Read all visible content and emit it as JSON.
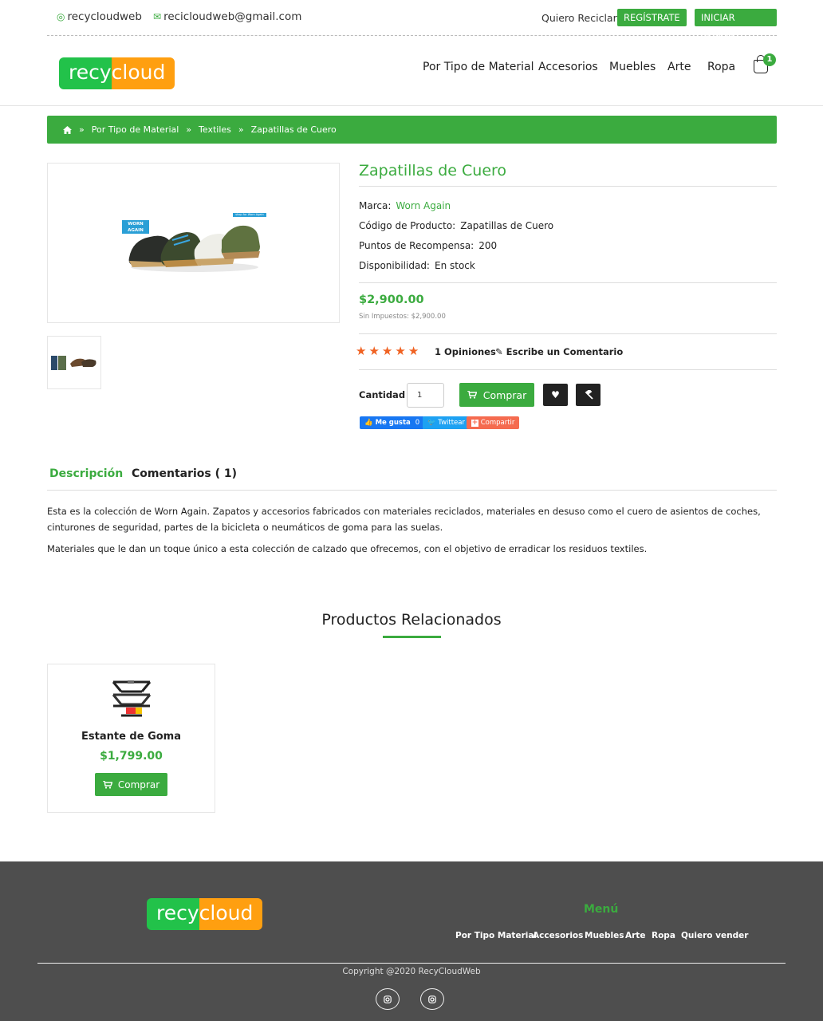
{
  "topbar": {
    "instagram": "recycloudweb",
    "email": "recicloudweb@gmail.com",
    "quiero_reciclar": "Quiero Reciclar",
    "register": "REGÍSTRATE",
    "login": "INICIAR SESIÓN"
  },
  "brand": {
    "logo_green": "recy",
    "logo_orange": "cloud"
  },
  "nav": {
    "items": [
      "Por Tipo de Material",
      "Accesorios",
      "Muebles",
      "Arte",
      "Ropa"
    ],
    "cart_count": "1"
  },
  "breadcrumb": [
    "Por Tipo de Material",
    "Textiles",
    "Zapatillas de Cuero"
  ],
  "product": {
    "title": "Zapatillas de Cuero",
    "brand_label": "Marca:",
    "brand_value": "Worn Again",
    "code_label": "Código de Producto:",
    "code_value": "Zapatillas de Cuero",
    "points_label": "Puntos de Recompensa:",
    "points_value": "200",
    "availability_label": "Disponibilidad:",
    "availability_value": "En stock",
    "price": "$2,900.00",
    "price_no_tax": "Sin Impuestos: $2,900.00",
    "rating": 5,
    "reviews_link": "1 Opiniones",
    "write_review": "Escribe un Comentario",
    "qty_label": "Cantidad",
    "qty_value": "1",
    "buy_label": "Comprar",
    "image_badge": "WORN AGAIN",
    "image_tag": "shop for Worn Again"
  },
  "social": {
    "like": "Me gusta",
    "like_count": "0",
    "tweet": "Twittear",
    "share": "Compartir"
  },
  "tabs": {
    "description": "Descripción",
    "comments": "Comentarios ( 1)"
  },
  "description": {
    "p1": "Esta es la colección de Worn Again. Zapatos y accesorios fabricados con materiales reciclados, materiales en desuso como el cuero de asientos de coches, cinturones de seguridad, partes de la bicicleta o neumáticos de goma para las suelas.",
    "p2": "Materiales que le dan un toque único a esta colección de calzado que ofrecemos, con el objetivo de erradicar los residuos textiles."
  },
  "related": {
    "title": "Productos Relacionados",
    "items": [
      {
        "name": "Estante de Goma",
        "price": "$1,799.00",
        "buy": "Comprar"
      }
    ]
  },
  "footer": {
    "menu_title": "Menú",
    "links": [
      "Por Tipo Material",
      "Accesorios",
      "Muebles",
      "Arte",
      "Ropa",
      "Quiero vender"
    ],
    "copyright": "Copyright @2020 RecyCloudWeb"
  },
  "colors": {
    "accent": "#3bab3f",
    "star": "#f06222",
    "footer_bg": "#4e4e4e",
    "logo_green": "#22c24a",
    "logo_orange": "#ff9f10"
  }
}
